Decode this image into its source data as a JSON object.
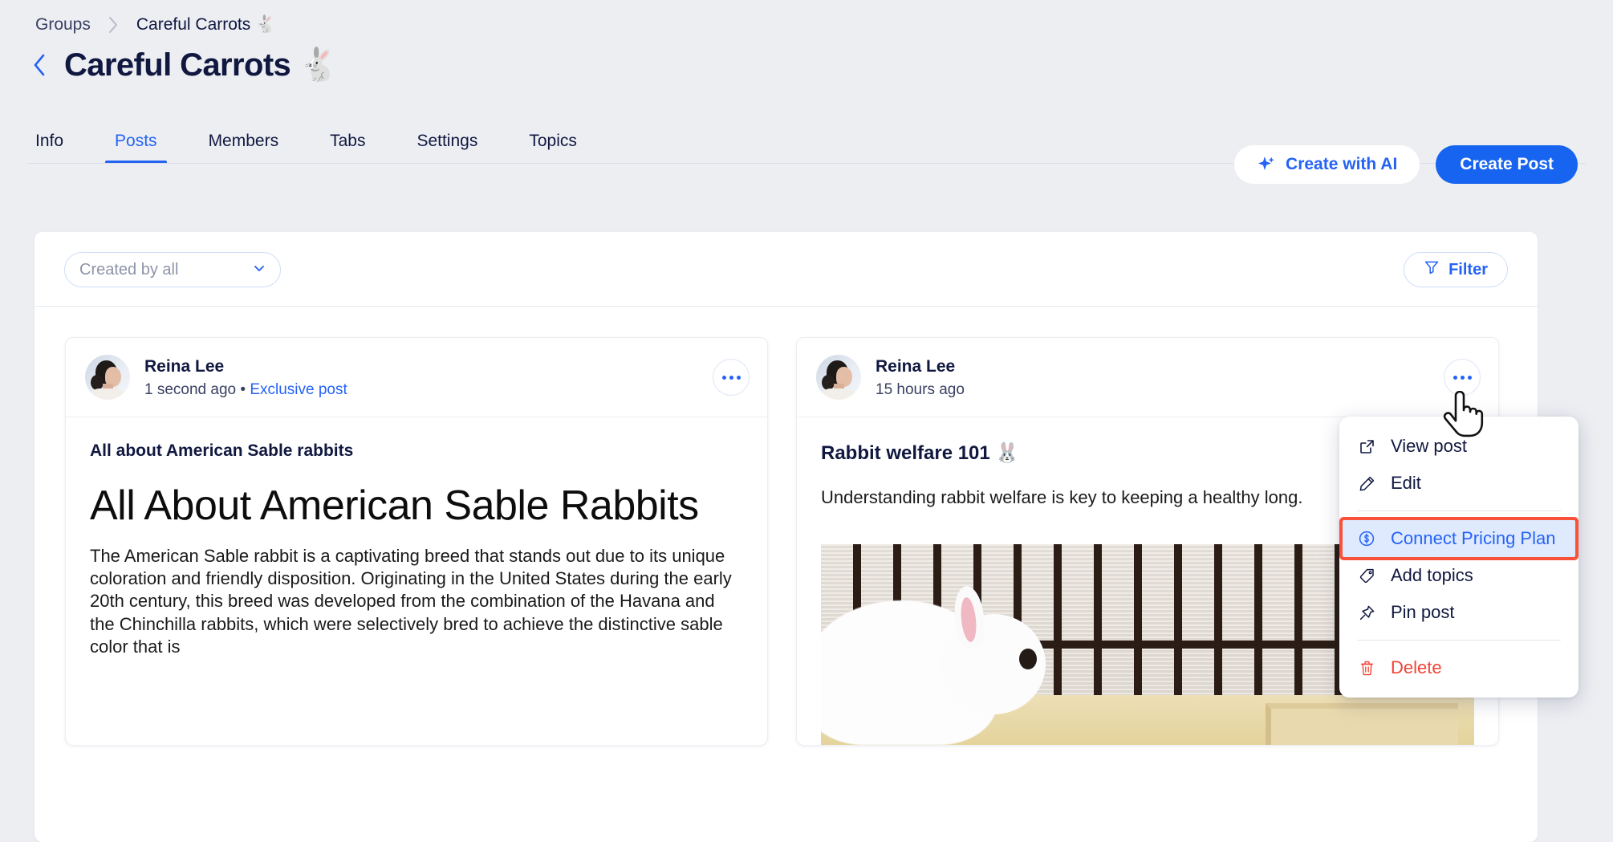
{
  "breadcrumb": {
    "root": "Groups",
    "separator_icon": "chevron-right-icon",
    "current": "Careful Carrots 🐇"
  },
  "header": {
    "back_icon": "chevron-left-icon",
    "title": "Careful Carrots 🐇"
  },
  "tabs": [
    {
      "label": "Info",
      "active": false
    },
    {
      "label": "Posts",
      "active": true
    },
    {
      "label": "Members",
      "active": false
    },
    {
      "label": "Tabs",
      "active": false
    },
    {
      "label": "Settings",
      "active": false
    },
    {
      "label": "Topics",
      "active": false
    }
  ],
  "header_actions": {
    "ai_icon": "sparkle-icon",
    "ai_label": "Create with AI",
    "create_label": "Create Post"
  },
  "filter_bar": {
    "created_by": {
      "placeholder": "Created by all",
      "chevron_icon": "chevron-down-icon"
    },
    "filter": {
      "icon": "funnel-icon",
      "label": "Filter"
    }
  },
  "posts": [
    {
      "author": "Reina Lee",
      "avatar_icon": "user-avatar",
      "time": "1 second ago",
      "separator": "•",
      "badge": "Exclusive post",
      "more_icon": "ellipsis-icon",
      "kicker": "All about American Sable rabbits",
      "heading": "All About American Sable Rabbits",
      "paragraph": "The American Sable rabbit is a captivating breed that stands out due to its unique coloration and friendly disposition. Originating in the United States during the early 20th century, this breed was developed from the combination of the Havana and the Chinchilla rabbits, which were selectively bred to achieve the distinctive sable color that is"
    },
    {
      "author": "Reina Lee",
      "avatar_icon": "user-avatar",
      "time": "15 hours ago",
      "more_icon": "ellipsis-icon",
      "title": "Rabbit welfare 101 🐰",
      "paragraph": "Understanding rabbit welfare is key to keeping a healthy long.",
      "image_alt": "white-rabbit-in-cage-photo"
    }
  ],
  "context_menu": {
    "items": [
      {
        "label": "View post",
        "icon": "external-link-icon",
        "state": "normal"
      },
      {
        "label": "Edit",
        "icon": "pencil-icon",
        "state": "normal"
      },
      {
        "label": "Connect Pricing Plan",
        "icon": "dollar-circle-icon",
        "state": "highlighted"
      },
      {
        "label": "Add topics",
        "icon": "tag-icon",
        "state": "normal"
      },
      {
        "label": "Pin post",
        "icon": "pin-icon",
        "state": "normal"
      },
      {
        "label": "Delete",
        "icon": "trash-icon",
        "state": "danger"
      }
    ]
  },
  "cursor": {
    "icon": "pointing-hand-cursor"
  },
  "colors": {
    "accent": "#2563f5",
    "primary_button": "#1764f0",
    "danger": "#f04437",
    "highlight_outline": "#f9523a",
    "highlight_bg": "#dfeaff",
    "page_bg": "#eceef2",
    "text": "#101840"
  }
}
